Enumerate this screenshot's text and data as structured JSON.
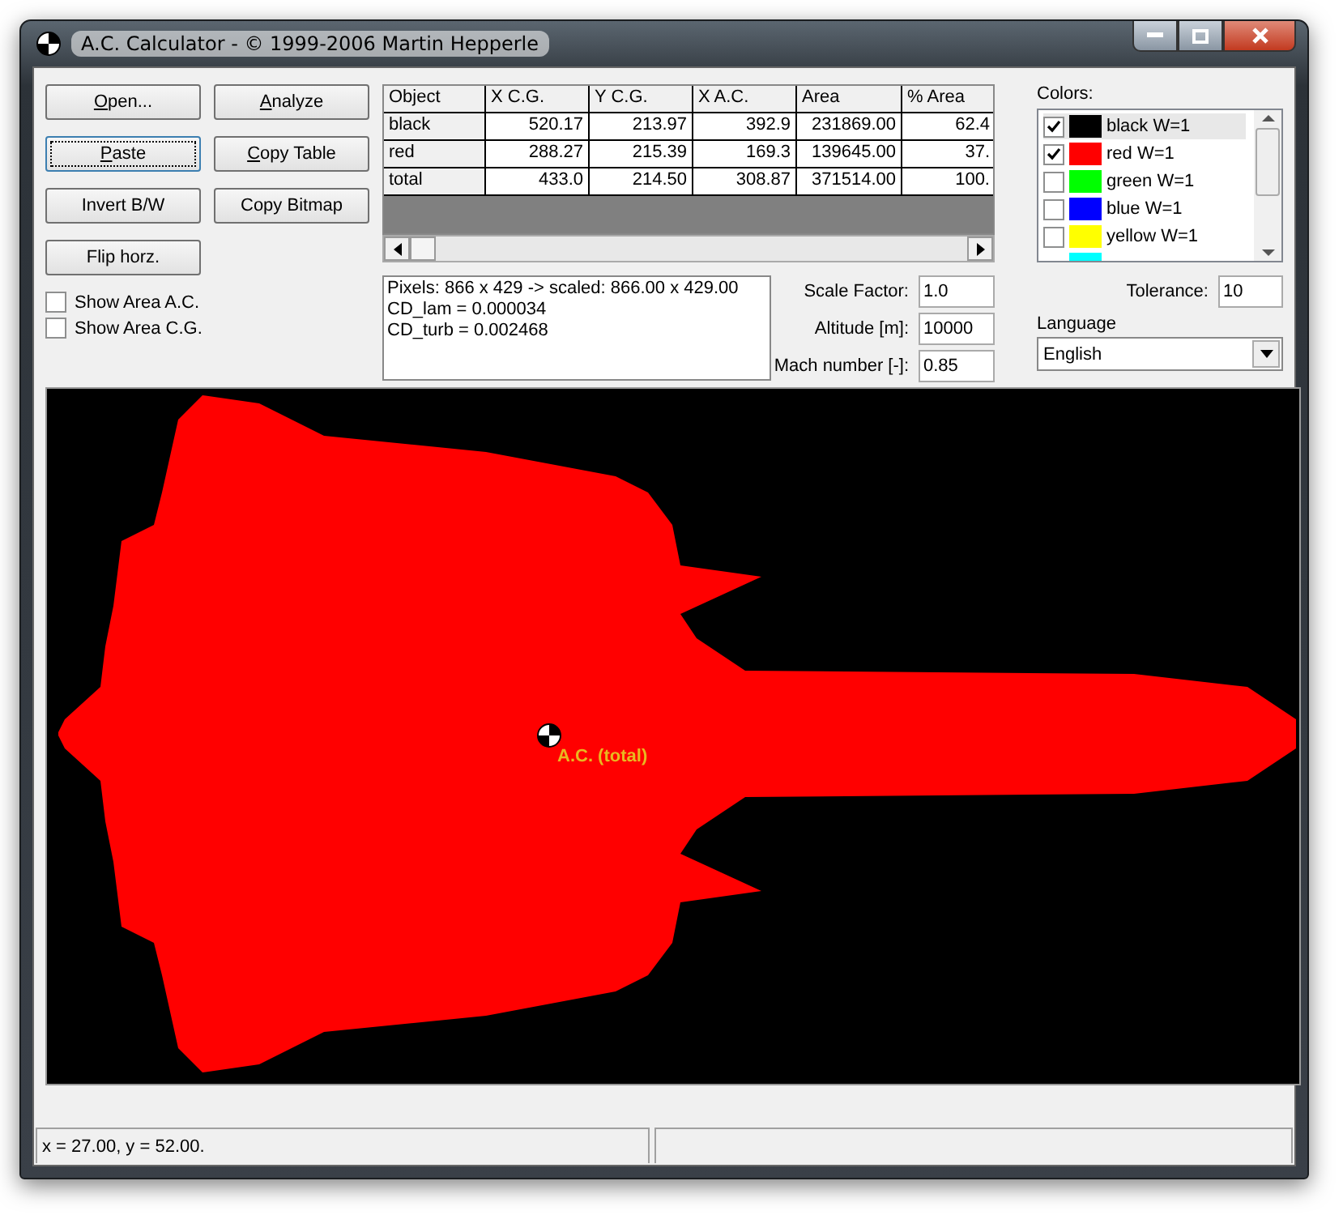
{
  "window": {
    "title": "A.C. Calculator - © 1999-2006 Martin Hepperle"
  },
  "buttons": [
    {
      "label": "Open...",
      "mnemonic": true,
      "focused": false
    },
    {
      "label": "Analyze",
      "mnemonic": true,
      "focused": false
    },
    {
      "label": "Paste",
      "mnemonic": true,
      "focused": true
    },
    {
      "label": "Copy Table",
      "mnemonic": true,
      "focused": false
    },
    {
      "label": "Invert B/W",
      "mnemonic": false,
      "focused": false
    },
    {
      "label": "Copy Bitmap",
      "mnemonic": false,
      "focused": false
    },
    {
      "label": "Flip horz.",
      "mnemonic": false,
      "focused": false
    }
  ],
  "checkboxes": [
    {
      "label": "Show Area A.C.",
      "checked": false
    },
    {
      "label": "Show Area C.G.",
      "checked": false
    }
  ],
  "table": {
    "columns": [
      "Object",
      "X  C.G.",
      "Y  C.G.",
      "X  A.C.",
      "Area",
      "% Area"
    ],
    "rows": [
      [
        "black",
        "520.17",
        "213.97",
        "392.9",
        "231869.00",
        "62.4"
      ],
      [
        "red",
        "288.27",
        "215.39",
        "169.3",
        "139645.00",
        "37."
      ],
      [
        "total",
        "433.0",
        "214.50",
        "308.87",
        "371514.00",
        "100."
      ]
    ]
  },
  "info": [
    "Pixels: 866 x 429 -> scaled: 866.00 x 429.00",
    "CD_lam = 0.000034",
    "CD_turb = 0.002468"
  ],
  "fields": [
    {
      "label": "Scale Factor:",
      "value": "1.0"
    },
    {
      "label": "Altitude [m]:",
      "value": "10000"
    },
    {
      "label": "Mach number [-]:",
      "value": "0.85"
    }
  ],
  "colors": {
    "label": "Colors:",
    "items": [
      {
        "label": "black W=1",
        "color": "#000000",
        "checked": true,
        "selected": true
      },
      {
        "label": "red W=1",
        "color": "#ff0000",
        "checked": true,
        "selected": false
      },
      {
        "label": "green W=1",
        "color": "#00ff00",
        "checked": false,
        "selected": false
      },
      {
        "label": "blue W=1",
        "color": "#0000ff",
        "checked": false,
        "selected": false
      },
      {
        "label": "yellow W=1",
        "color": "#ffff00",
        "checked": false,
        "selected": false
      },
      {
        "color": "#00ffff",
        "selected": false
      }
    ]
  },
  "tolerance": {
    "label": "Tolerance:",
    "value": "10"
  },
  "language": {
    "label": "Language",
    "value": "English"
  },
  "canvas": {
    "marker_label": "A.C. (total)"
  },
  "status_bar": [
    "x = 27.00, y = 52.00."
  ]
}
